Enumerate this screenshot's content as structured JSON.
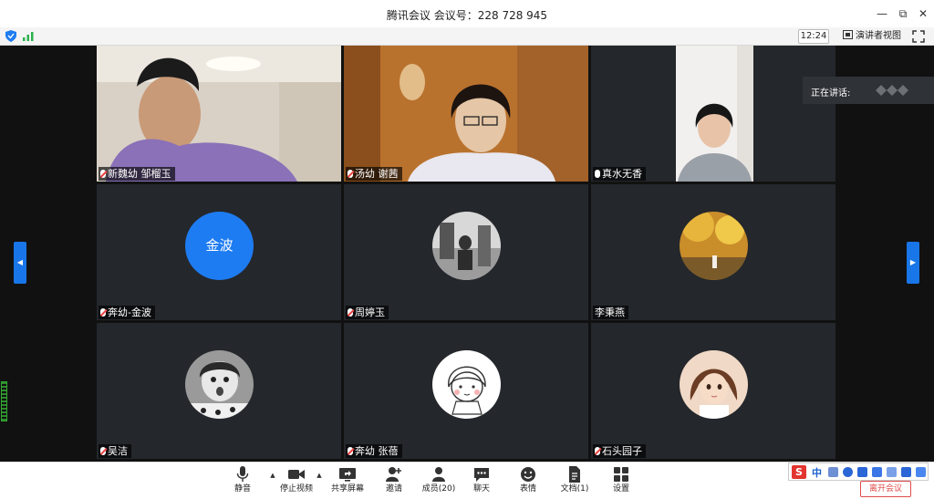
{
  "window": {
    "title": "腾讯会议 会议号：228 728 945",
    "minimize": "—",
    "restore": "⧉",
    "close": "✕"
  },
  "toolbar": {
    "clock": "12:24",
    "speaker_view_label": "演讲者视图"
  },
  "speaking": {
    "label": "正在讲话:"
  },
  "nav": {
    "prev": "◀",
    "next": "▶"
  },
  "tiles": [
    {
      "name": "新魏幼 邹榴玉",
      "muted": true,
      "kind": "video"
    },
    {
      "name": "汤幼 谢茜",
      "muted": true,
      "kind": "video"
    },
    {
      "name": "真水无香",
      "muted": false,
      "kind": "video"
    },
    {
      "name": "奔幼-金波",
      "muted": true,
      "kind": "text-avatar",
      "avatar_text": "金波"
    },
    {
      "name": "周婷玉",
      "muted": true,
      "kind": "photo-avatar"
    },
    {
      "name": "李秉燕",
      "muted": false,
      "kind": "photo-avatar"
    },
    {
      "name": "吴洁",
      "muted": true,
      "kind": "photo-avatar"
    },
    {
      "name": "奔幼 张蓓",
      "muted": true,
      "kind": "photo-avatar"
    },
    {
      "name": "石头园子",
      "muted": true,
      "kind": "photo-avatar"
    }
  ],
  "bottom_bar": {
    "mute": "静音",
    "stop_video": "停止视频",
    "share_screen": "共享屏幕",
    "invite": "邀请",
    "members": "成员(20)",
    "chat": "聊天",
    "reactions": "表情",
    "docs": "文档(1)",
    "settings": "设置",
    "leave": "离开会议"
  },
  "ime": {
    "brand": "S",
    "lang": "中"
  },
  "colors": {
    "accent": "#1e7cf2",
    "tile_bg": "#24272b",
    "leave_red": "#e14b4b"
  }
}
